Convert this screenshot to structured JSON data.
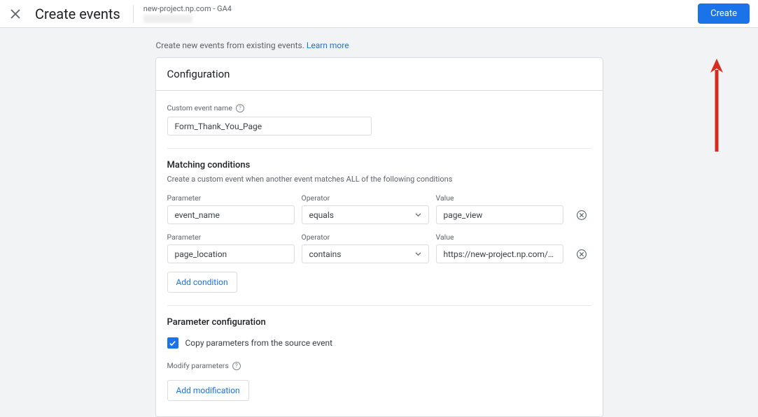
{
  "header": {
    "title": "Create events",
    "project_name": "new-project.np.com - GA4",
    "create_label": "Create"
  },
  "intro": {
    "text": "Create new events from existing events. ",
    "link": "Learn more"
  },
  "config": {
    "heading": "Configuration",
    "custom_name_label": "Custom event name",
    "custom_name_value": "Form_Thank_You_Page"
  },
  "match": {
    "heading": "Matching conditions",
    "sub": "Create a custom event when another event matches ALL of the following conditions",
    "labels": {
      "parameter": "Parameter",
      "operator": "Operator",
      "value": "Value"
    },
    "rows": [
      {
        "parameter": "event_name",
        "operator": "equals",
        "value": "page_view"
      },
      {
        "parameter": "page_location",
        "operator": "contains",
        "value": "https://new-project.np.com/thank-you"
      }
    ],
    "add_condition": "Add condition"
  },
  "params": {
    "heading": "Parameter configuration",
    "copy": "Copy parameters from the source event",
    "modify_label": "Modify parameters",
    "add_modification": "Add modification"
  }
}
